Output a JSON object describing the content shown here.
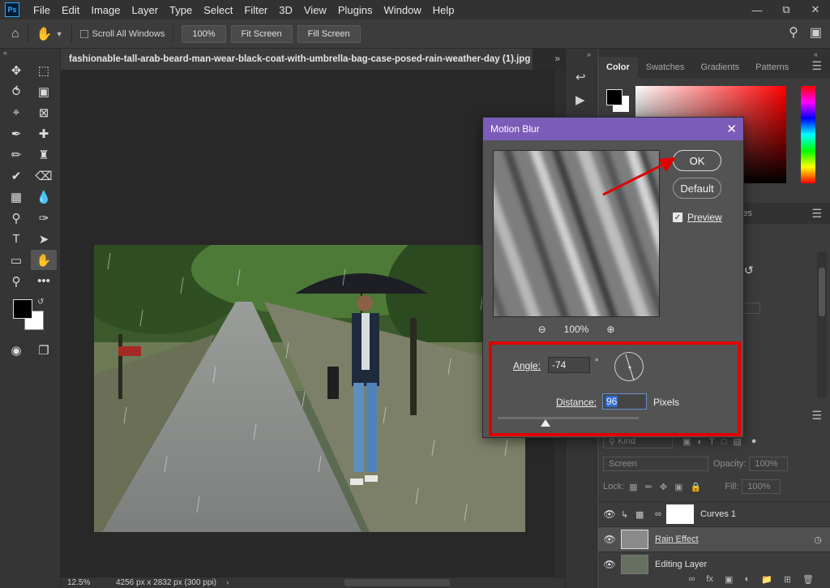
{
  "app": {
    "logo": "Ps",
    "menu": [
      "File",
      "Edit",
      "Image",
      "Layer",
      "Type",
      "Select",
      "Filter",
      "3D",
      "View",
      "Plugins",
      "Window",
      "Help"
    ]
  },
  "options_bar": {
    "scroll_all_windows": "Scroll All Windows",
    "zoom_100": "100%",
    "fit_screen": "Fit Screen",
    "fill_screen": "Fill Screen"
  },
  "document": {
    "tab_title": "fashionable-tall-arab-beard-man-wear-black-coat-with-umbrella-bag-case-posed-rain-weather-day (1).jpg",
    "zoom": "12.5%",
    "size": "4256 px x 2832 px (300 ppi)"
  },
  "panels": {
    "tabs": [
      "Color",
      "Swatches",
      "Gradients",
      "Patterns"
    ],
    "active_tab": "Color",
    "partial_tab_label": "ies",
    "layers": {
      "kind_placeholder": "Kind",
      "blend_mode": "Screen",
      "opacity_label": "Opacity:",
      "opacity_value": "100%",
      "lock_label": "Lock:",
      "fill_label": "Fill:",
      "fill_value": "100%",
      "items": [
        {
          "name": "Curves 1"
        },
        {
          "name": "Rain Effect"
        },
        {
          "name": "Editing Layer"
        }
      ]
    }
  },
  "dialog": {
    "title": "Motion Blur",
    "ok": "OK",
    "default": "Default",
    "preview_label": "Preview",
    "preview_zoom": "100%",
    "angle_label": "Angle:",
    "angle_value": "-74",
    "degree_sign": "°",
    "distance_label": "Distance:",
    "distance_value": "96",
    "pixels_label": "Pixels"
  },
  "colors": {
    "dialog_titlebar": "#7b5cb8",
    "highlight": "#e00000"
  }
}
